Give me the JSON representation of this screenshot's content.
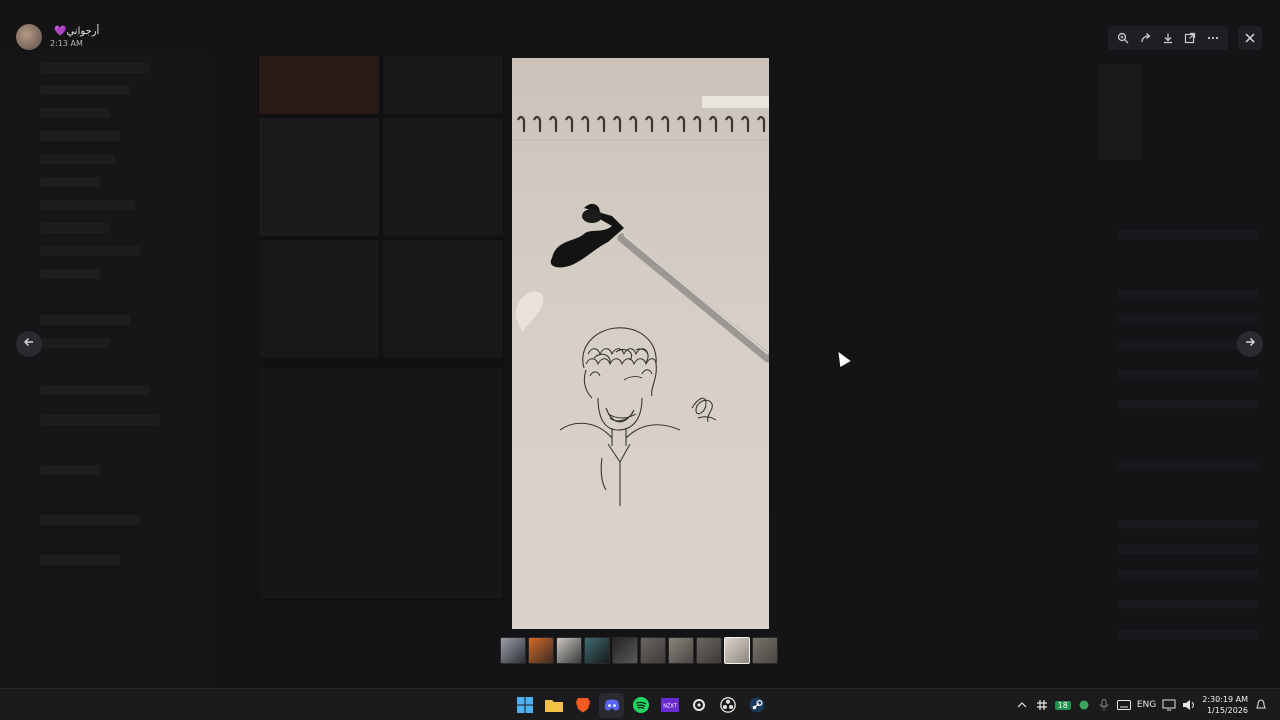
{
  "user": {
    "name": "أرجواني",
    "heart": "💜",
    "time": "2:13 AM"
  },
  "toolbar": {
    "zoom_icon": "zoom-in-icon",
    "forward_icon": "forward-icon",
    "download_icon": "download-icon",
    "open_icon": "open-external-icon",
    "more_icon": "more-icon",
    "close_icon": "close-icon"
  },
  "nav": {
    "prev_icon": "arrow-left-icon",
    "next_icon": "arrow-right-icon"
  },
  "thumbnails": {
    "count": 10,
    "active_index": 8
  },
  "taskbar": {
    "apps": [
      {
        "name": "start",
        "icon": "windows-icon"
      },
      {
        "name": "file-explorer",
        "icon": "folder-icon"
      },
      {
        "name": "brave",
        "icon": "brave-icon"
      },
      {
        "name": "discord",
        "icon": "discord-icon"
      },
      {
        "name": "spotify",
        "icon": "spotify-icon"
      },
      {
        "name": "nzxt",
        "icon": "nzxt-icon"
      },
      {
        "name": "steam-settings",
        "icon": "settings-icon"
      },
      {
        "name": "obs",
        "icon": "obs-icon"
      },
      {
        "name": "steam",
        "icon": "steam-icon"
      }
    ],
    "tray": {
      "badge": "18",
      "lang": "ENG",
      "time": "2:30:19 AM",
      "date": "1/15/2026"
    }
  },
  "colors": {
    "accent_purple": "#a77be8",
    "badge_green": "#1f8f4a"
  }
}
